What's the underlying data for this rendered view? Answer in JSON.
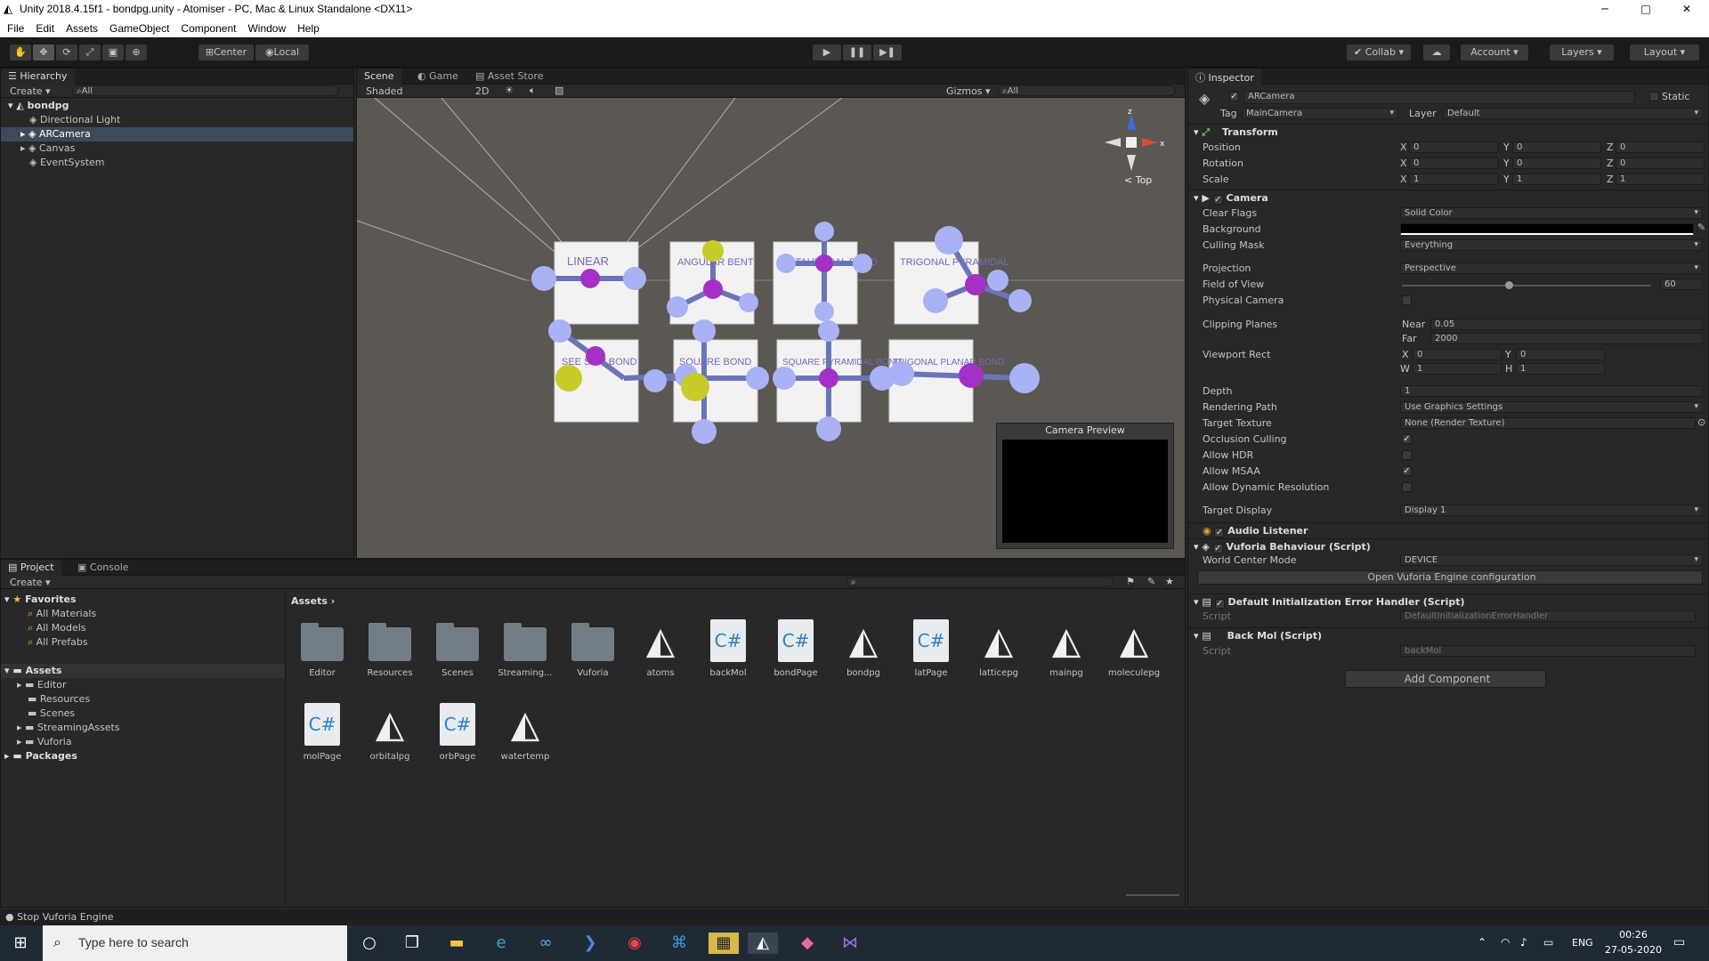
{
  "window": {
    "title": "Unity 2018.4.15f1 - bondpg.unity - Atomiser - PC, Mac & Linux Standalone <DX11>",
    "minimize": "─",
    "maximize": "□",
    "close": "✕"
  },
  "menu": [
    "File",
    "Edit",
    "Assets",
    "GameObject",
    "Component",
    "Window",
    "Help"
  ],
  "toolbar": {
    "pivot": "Center",
    "space": "Local",
    "collab": "Collab",
    "account": "Account",
    "layers": "Layers",
    "layout": "Layout"
  },
  "hierarchy": {
    "tab": "Hierarchy",
    "create": "Create",
    "search_placeholder": "All",
    "scene": "bondpg",
    "items": [
      "Directional Light",
      "ARCamera",
      "Canvas",
      "EventSystem"
    ]
  },
  "scene_view": {
    "tabs": [
      "Scene",
      "Game",
      "Asset Store"
    ],
    "shading": "Shaded",
    "mode2d": "2D",
    "gizmos": "Gizmos",
    "search": "All",
    "gizmo_label": "Top",
    "camera_preview": "Camera Preview",
    "cards": [
      "LINEAR",
      "ANGULAR BENT",
      "OCTAHEDRAL BOND",
      "TRIGONAL PYRAMIDAL",
      "SEE SAW BOND",
      "SQUARE BOND",
      "SQUARE PYRAMIDAL BOND",
      "TRIGONAL PLANAR BOND"
    ]
  },
  "project": {
    "tabs": [
      "Project",
      "Console"
    ],
    "create": "Create",
    "favorites_label": "Favorites",
    "favorites": [
      "All Materials",
      "All Models",
      "All Prefabs"
    ],
    "assets_label": "Assets",
    "asset_folders": [
      "Editor",
      "Resources",
      "Scenes",
      "StreamingAssets",
      "Vuforia"
    ],
    "packages_label": "Packages",
    "breadcrumb": "Assets",
    "files": [
      {
        "name": "Editor",
        "type": "folder"
      },
      {
        "name": "Resources",
        "type": "folder"
      },
      {
        "name": "Scenes",
        "type": "folder"
      },
      {
        "name": "Streaming...",
        "type": "folder"
      },
      {
        "name": "Vuforia",
        "type": "folder"
      },
      {
        "name": "atoms",
        "type": "unity"
      },
      {
        "name": "backMol",
        "type": "cs"
      },
      {
        "name": "bondPage",
        "type": "cs"
      },
      {
        "name": "bondpg",
        "type": "unity"
      },
      {
        "name": "latPage",
        "type": "cs"
      },
      {
        "name": "latticepg",
        "type": "unity"
      },
      {
        "name": "mainpg",
        "type": "unity"
      },
      {
        "name": "moleculepg",
        "type": "unity"
      },
      {
        "name": "molPage",
        "type": "cs"
      },
      {
        "name": "orbitalpg",
        "type": "unity"
      },
      {
        "name": "orbPage",
        "type": "cs"
      },
      {
        "name": "watertemp",
        "type": "unity"
      }
    ]
  },
  "status": "Stop Vuforia Engine",
  "inspector": {
    "tab": "Inspector",
    "object_name": "ARCamera",
    "static": "Static",
    "tag_label": "Tag",
    "tag": "MainCamera",
    "layer_label": "Layer",
    "layer": "Default",
    "transform": {
      "title": "Transform",
      "rows": [
        {
          "label": "Position",
          "x": "0",
          "y": "0",
          "z": "0"
        },
        {
          "label": "Rotation",
          "x": "0",
          "y": "0",
          "z": "0"
        },
        {
          "label": "Scale",
          "x": "1",
          "y": "1",
          "z": "1"
        }
      ]
    },
    "camera": {
      "title": "Camera",
      "clear_flags_label": "Clear Flags",
      "clear_flags": "Solid Color",
      "background_label": "Background",
      "culling_mask_label": "Culling Mask",
      "culling_mask": "Everything",
      "projection_label": "Projection",
      "projection": "Perspective",
      "fov_label": "Field of View",
      "fov": "60",
      "fov_fraction": 0.43,
      "physical_label": "Physical Camera",
      "clipping_label": "Clipping Planes",
      "near_label": "Near",
      "near": "0.05",
      "far_label": "Far",
      "far": "2000",
      "viewport_label": "Viewport Rect",
      "vx": "0",
      "vy": "0",
      "vw": "1",
      "vh": "1",
      "depth_label": "Depth",
      "depth": "1",
      "rendering_path_label": "Rendering Path",
      "rendering_path": "Use Graphics Settings",
      "target_texture_label": "Target Texture",
      "target_texture": "None (Render Texture)",
      "occlusion_label": "Occlusion Culling",
      "hdr_label": "Allow HDR",
      "msaa_label": "Allow MSAA",
      "dynres_label": "Allow Dynamic Resolution",
      "target_display_label": "Target Display",
      "target_display": "Display 1"
    },
    "audio_listener": "Audio Listener",
    "vuforia": {
      "title": "Vuforia Behaviour (Script)",
      "wcm_label": "World Center Mode",
      "wcm": "DEVICE",
      "open_config": "Open Vuforia Engine configuration"
    },
    "error_handler": {
      "title": "Default Initialization Error Handler (Script)",
      "script_label": "Script",
      "script": "DefaultInitializationErrorHandler"
    },
    "back_mol": {
      "title": "Back Mol (Script)",
      "script_label": "Script",
      "script": "backMol"
    },
    "add_component": "Add Component"
  },
  "taskbar": {
    "search_placeholder": "Type here to search",
    "lang": "ENG",
    "time": "00:26",
    "date": "27-05-2020"
  },
  "colors": {
    "accent": "#3d6fa6",
    "panel": "#282828",
    "taskbar": "#202a35"
  }
}
